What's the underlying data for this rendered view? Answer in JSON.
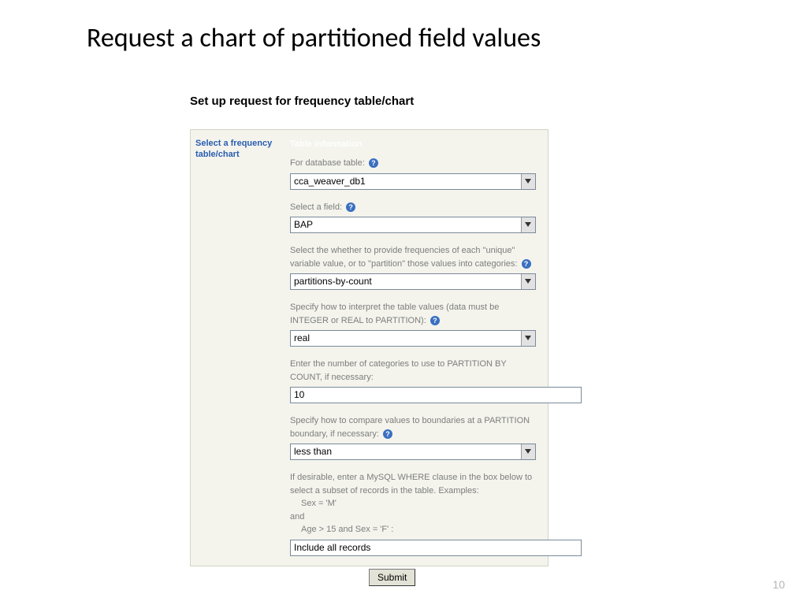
{
  "title": "Request a chart of partitioned field values",
  "subtitle": "Set up request for frequency table/chart",
  "sidebar_label": "Select a frequency table/chart",
  "section_heading": "Table information",
  "fields": {
    "db": {
      "label": "For database table:",
      "value": "cca_weaver_db1"
    },
    "field": {
      "label": "Select a field:",
      "value": "BAP"
    },
    "mode": {
      "label": "Select the whether to provide frequencies of each \"unique\" variable value, or to \"partition\" those values into categories:",
      "value": "partitions-by-count"
    },
    "dtype": {
      "label": "Specify how to interpret the table values (data must be INTEGER or REAL to PARTITION):",
      "value": "real"
    },
    "ncat": {
      "label": "Enter the number of categories to use to PARTITION BY COUNT, if necessary:",
      "value": "10"
    },
    "cmp": {
      "label": "Specify how to compare values to boundaries at a PARTITION boundary, if necessary:",
      "value": "less than"
    },
    "where": {
      "intro": "If desirable, enter a MySQL WHERE clause in the box below to select a subset of records in the table. Examples:",
      "ex1": "Sex = 'M'",
      "and": "and",
      "ex2": "Age > 15 and Sex = 'F' :",
      "value": "Include all records"
    }
  },
  "submit_label": "Submit",
  "page_number": "10",
  "help_glyph": "?"
}
